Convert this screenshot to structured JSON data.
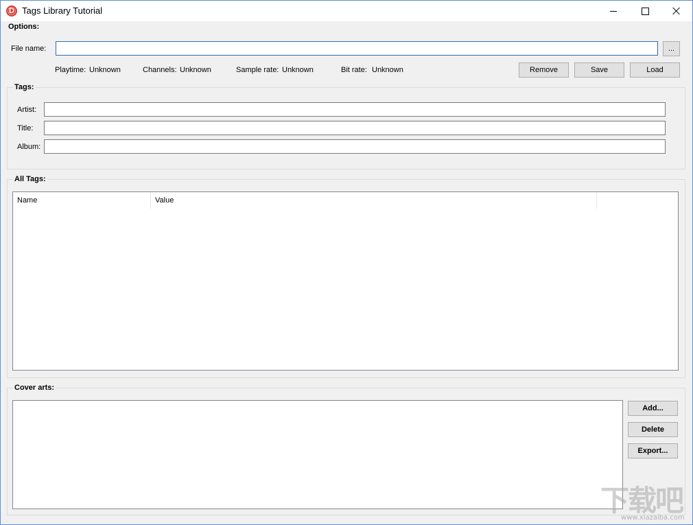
{
  "window": {
    "title": "Tags Library Tutorial",
    "icon": "delphi-logo-icon",
    "controls": {
      "minimize": "minimize-icon",
      "maximize": "maximize-icon",
      "close": "close-icon"
    }
  },
  "options": {
    "group_label": "Options:",
    "file_name_label": "File name:",
    "file_name_value": "",
    "browse_label": "...",
    "playtime_label": "Playtime:",
    "playtime_value": "Unknown",
    "channels_label": "Channels:",
    "channels_value": "Unknown",
    "sample_rate_label": "Sample rate:",
    "sample_rate_value": "Unknown",
    "bit_rate_label": "Bit rate:",
    "bit_rate_value": "Unknown",
    "remove_label": "Remove",
    "save_label": "Save",
    "load_label": "Load"
  },
  "tags": {
    "group_label": "Tags:",
    "artist_label": "Artist:",
    "artist_value": "",
    "title_label": "Title:",
    "title_value": "",
    "album_label": "Album:",
    "album_value": ""
  },
  "all_tags": {
    "group_label": "All Tags:",
    "columns": [
      "Name",
      "Value",
      ""
    ],
    "rows": []
  },
  "cover_arts": {
    "group_label": "Cover arts:",
    "add_label": "Add...",
    "delete_label": "Delete",
    "export_label": "Export..."
  },
  "watermark": {
    "big_text": "下载吧",
    "small_text": "www.xiazaiba.com"
  }
}
